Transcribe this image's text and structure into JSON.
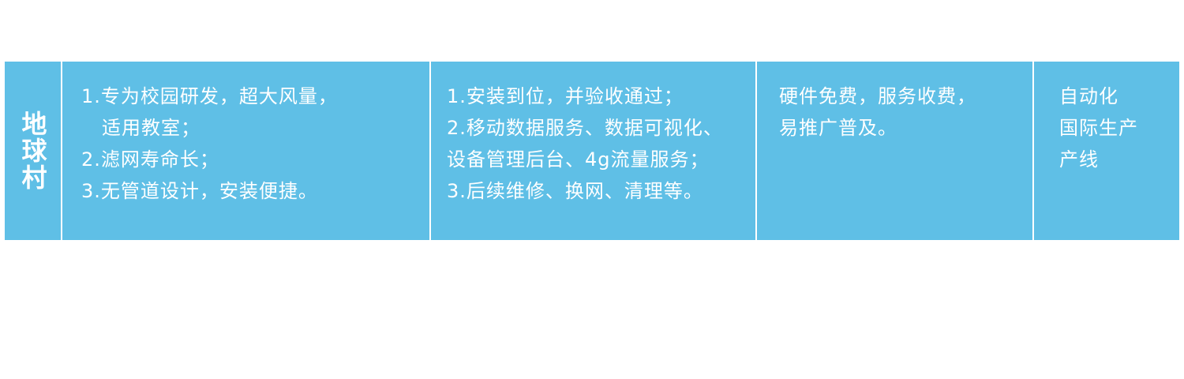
{
  "row": {
    "name": "地球村",
    "features": [
      "1.专为校园研发，超大风量，",
      "适用教室；",
      "2.滤网寿命长；",
      "3.无管道设计，安装便捷。"
    ],
    "services": [
      "1.安装到位，并验收通过；",
      "2.移动数据服务、数据可视化、",
      "设备管理后台、4g流量服务；",
      "3.后续维修、换网、清理等。"
    ],
    "pricing": [
      "硬件免费，服务收费，",
      "易推广普及。"
    ],
    "production": [
      "自动化",
      "国际生产",
      "产线"
    ]
  },
  "colors": {
    "cell_background": "#5fbfe6",
    "text": "#ffffff",
    "divider": "#ffffff"
  }
}
